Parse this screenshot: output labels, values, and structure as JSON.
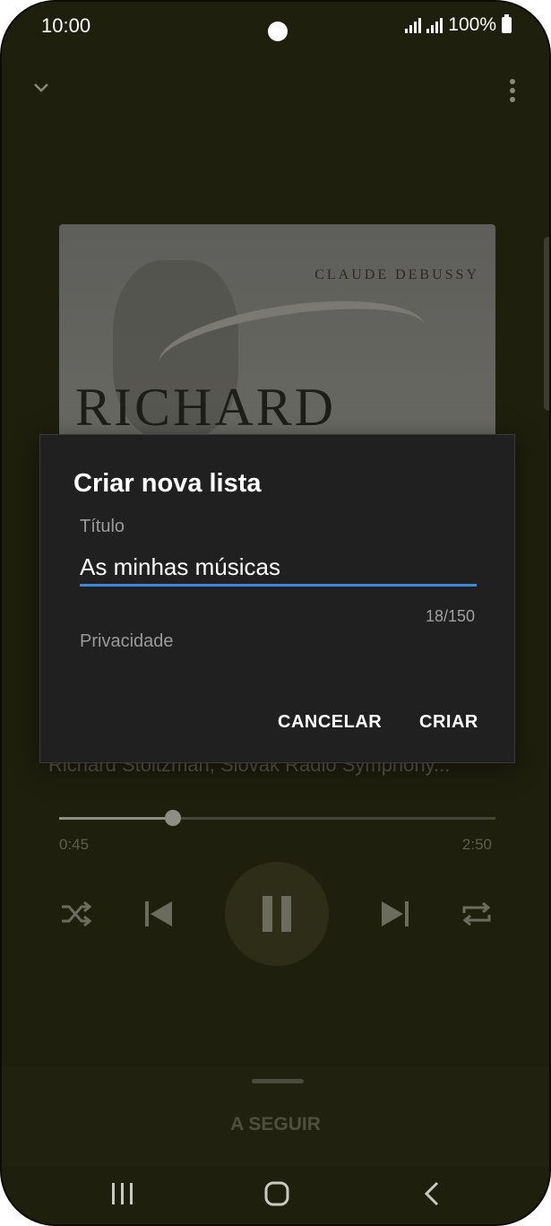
{
  "status_bar": {
    "time": "10:00",
    "battery": "100%"
  },
  "now_playing": {
    "album_art": {
      "composer": "CLAUDE DEBUSSY",
      "name": "RICHARD"
    },
    "artist": "Richard Stoltzman, Slovak Radio Symphony...",
    "elapsed": "0:45",
    "duration": "2:50",
    "progress": 0.26
  },
  "up_next": {
    "label": "A SEGUIR"
  },
  "dialog": {
    "title": "Criar nova lista",
    "title_field_label": "Título",
    "title_value": "As minhas músicas",
    "counter": "18/150",
    "privacy_label": "Privacidade",
    "cancel_label": "CANCELAR",
    "create_label": "CRIAR"
  },
  "colors": {
    "accent": "#3d88d8",
    "dialog_bg": "#202020"
  }
}
